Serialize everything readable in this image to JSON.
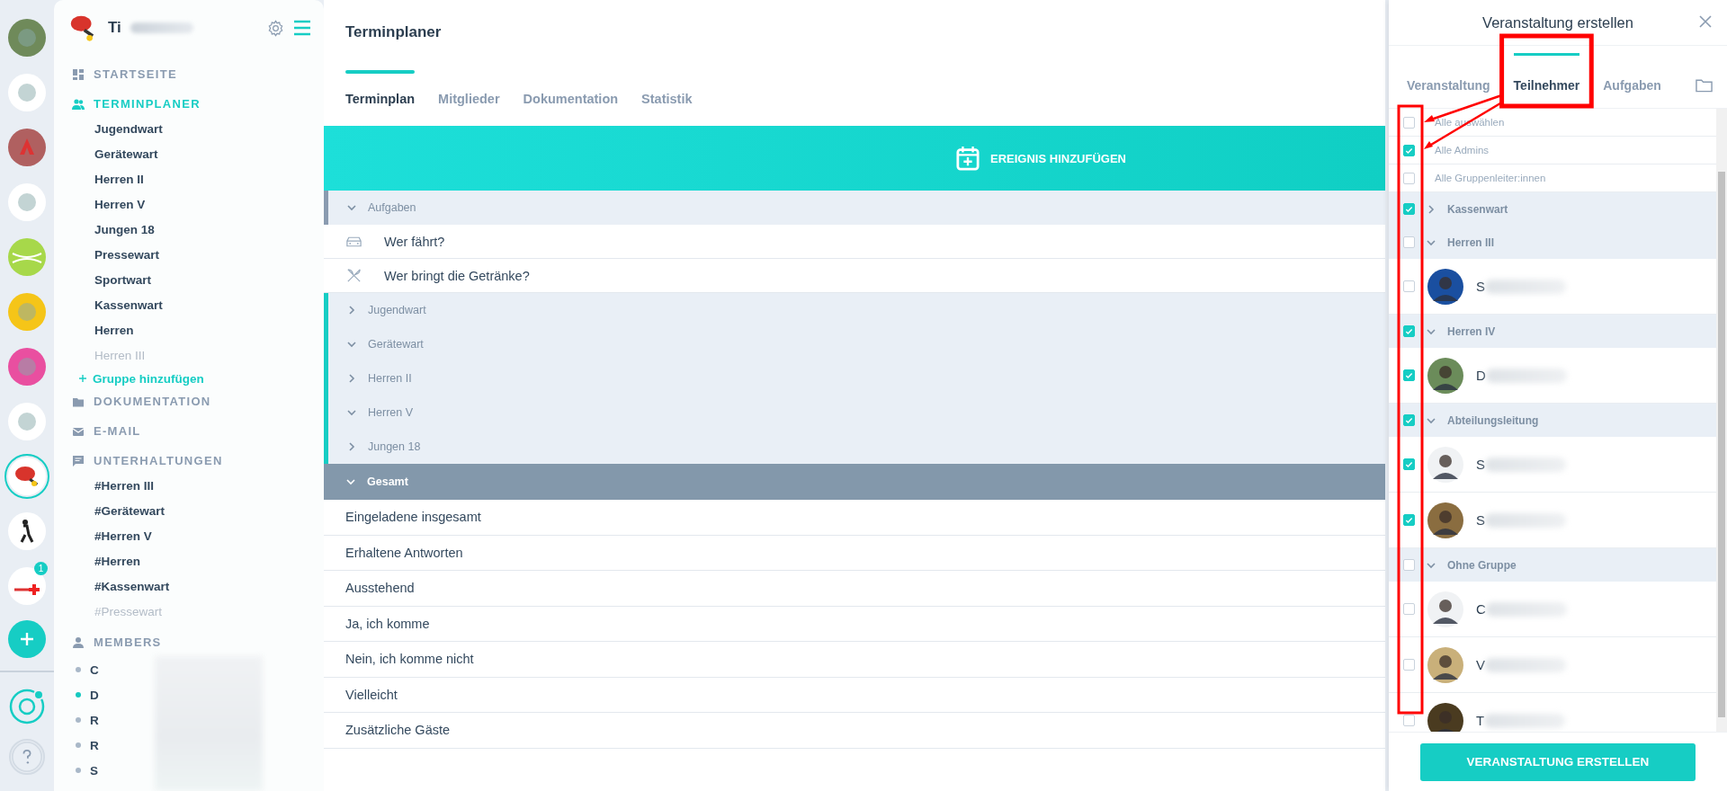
{
  "rail": {
    "workspaces": [
      {
        "selected": false
      },
      {
        "selected": false
      },
      {
        "selected": false
      },
      {
        "selected": false
      },
      {
        "selected": false
      },
      {
        "selected": false
      },
      {
        "selected": false
      },
      {
        "selected": false
      },
      {
        "selected": true
      },
      {
        "selected": false
      },
      {
        "selected": false,
        "badge": "1"
      }
    ]
  },
  "sidebar": {
    "workspace_name": "Ti",
    "sections": [
      {
        "label": "STARTSEITE",
        "selected": false
      },
      {
        "label": "TERMINPLANER",
        "selected": true,
        "items": [
          {
            "label": "Jugendwart",
            "muted": false
          },
          {
            "label": "Gerätewart",
            "muted": false
          },
          {
            "label": "Herren II",
            "muted": false
          },
          {
            "label": "Herren V",
            "muted": false
          },
          {
            "label": "Jungen 18",
            "muted": false
          },
          {
            "label": "Pressewart",
            "muted": false
          },
          {
            "label": "Sportwart",
            "muted": false
          },
          {
            "label": "Kassenwart",
            "muted": false
          },
          {
            "label": "Herren",
            "muted": false
          },
          {
            "label": "Herren III",
            "muted": true
          }
        ],
        "add_label": "Gruppe hinzufügen"
      },
      {
        "label": "DOKUMENTATION",
        "selected": false
      },
      {
        "label": "E-MAIL",
        "selected": false
      },
      {
        "label": "UNTERHALTUNGEN",
        "selected": false,
        "items": [
          {
            "label": "#Herren III",
            "muted": false
          },
          {
            "label": "#Gerätewart",
            "muted": false
          },
          {
            "label": "#Herren V",
            "muted": false
          },
          {
            "label": "#Herren",
            "muted": false
          },
          {
            "label": "#Kassenwart",
            "muted": false
          },
          {
            "label": "#Pressewart",
            "muted": true
          }
        ]
      },
      {
        "label": "MEMBERS",
        "selected": false,
        "members": [
          {
            "label": "C",
            "color": "#a9b8c8"
          },
          {
            "label": "D",
            "color": "#16c9c0"
          },
          {
            "label": "R",
            "color": "#a9b8c8"
          },
          {
            "label": "R",
            "color": "#a9b8c8"
          },
          {
            "label": "S",
            "color": "#a9b8c8"
          }
        ]
      }
    ]
  },
  "main": {
    "title": "Terminplaner",
    "tabs": [
      {
        "label": "Terminplan",
        "selected": true
      },
      {
        "label": "Mitglieder",
        "selected": false
      },
      {
        "label": "Dokumentation",
        "selected": false
      },
      {
        "label": "Statistik",
        "selected": false
      }
    ],
    "add_button": "EREIGNIS HINZUFÜGEN",
    "groups": [
      {
        "name": "Aufgaben",
        "kind": "tasks",
        "expanded": true,
        "tasks": [
          {
            "label": "Wer fährt?"
          },
          {
            "label": "Wer bringt die Getränke?"
          }
        ]
      },
      {
        "name": "Jugendwart",
        "kind": "group",
        "expanded": false
      },
      {
        "name": "Gerätewart",
        "kind": "group",
        "expanded": true
      },
      {
        "name": "Herren II",
        "kind": "group",
        "expanded": false
      },
      {
        "name": "Herren V",
        "kind": "group",
        "expanded": true
      },
      {
        "name": "Jungen 18",
        "kind": "group",
        "expanded": false
      }
    ],
    "total": {
      "label": "Gesamt",
      "expanded": true,
      "rows": [
        "Eingeladene insgesamt",
        "Erhaltene Antworten",
        "Ausstehend",
        "Ja, ich komme",
        "Nein, ich komme nicht",
        "Vielleicht",
        "Zusätzliche Gäste"
      ]
    }
  },
  "panel": {
    "title": "Veranstaltung erstellen",
    "tabs": [
      {
        "label": "Veranstaltung",
        "selected": false
      },
      {
        "label": "Teilnehmer",
        "selected": true
      },
      {
        "label": "Aufgaben",
        "selected": false
      }
    ],
    "quick": [
      {
        "label": "Alle auswählen",
        "checked": false
      },
      {
        "label": "Alle Admins",
        "checked": true
      },
      {
        "label": "Alle Gruppenleiter:innen",
        "checked": false
      }
    ],
    "groups": [
      {
        "name": "Kassenwart",
        "checked": true,
        "expanded": false
      },
      {
        "name": "Herren III",
        "checked": false,
        "expanded": true,
        "members": [
          {
            "initial": "S",
            "checked": false
          }
        ]
      },
      {
        "name": "Herren IV",
        "checked": true,
        "expanded": true,
        "members": [
          {
            "initial": "D",
            "checked": true
          }
        ]
      },
      {
        "name": "Abteilungsleitung",
        "checked": true,
        "expanded": true,
        "members": [
          {
            "initial": "S",
            "checked": true
          },
          {
            "initial": "S",
            "checked": true
          }
        ]
      },
      {
        "name": "Ohne Gruppe",
        "checked": false,
        "expanded": true,
        "members": [
          {
            "initial": "C",
            "checked": false
          },
          {
            "initial": "V",
            "checked": false
          },
          {
            "initial": "T",
            "checked": false
          }
        ]
      }
    ],
    "submit": "VERANSTALTUNG ERSTELLEN"
  }
}
